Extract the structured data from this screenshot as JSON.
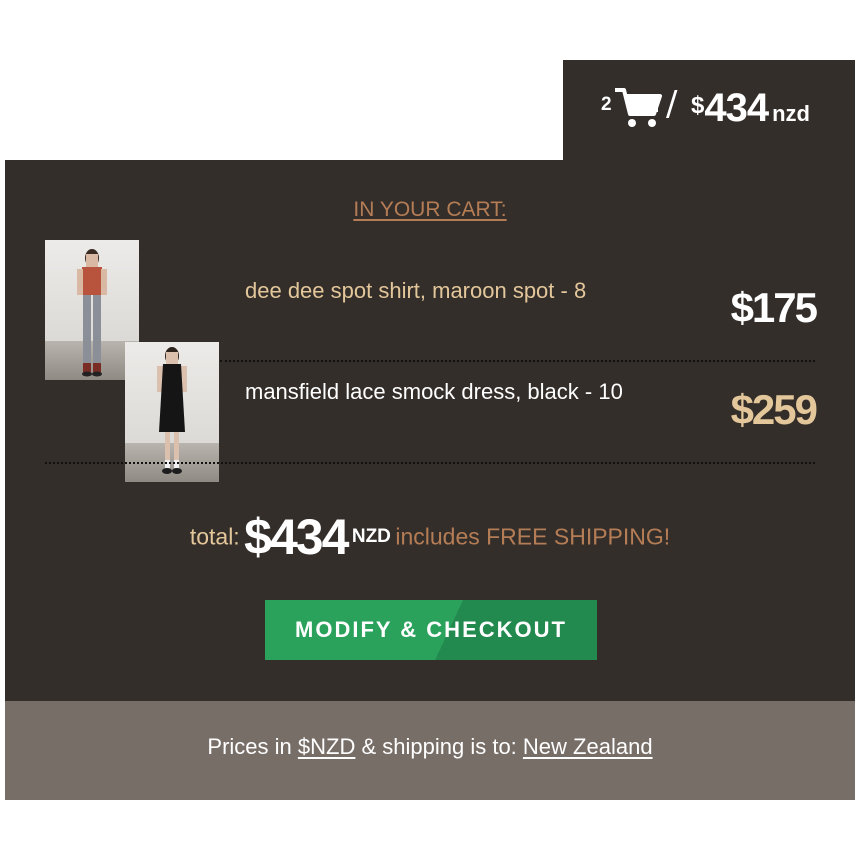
{
  "cart_tab": {
    "count": "2",
    "separator": "/",
    "currency_symbol": "$",
    "total": "434",
    "unit": "nzd",
    "icon": "shopping-cart-icon"
  },
  "cart": {
    "heading": "IN YOUR CART:",
    "items": [
      {
        "name": "dee dee spot shirt, maroon spot - 8",
        "price": "$175",
        "name_color": "#e3c79a",
        "price_color": "#ffffff",
        "image": "model wearing maroon spot shirt and grey trousers"
      },
      {
        "name": "mansfield lace smock dress, black - 10",
        "price": "$259",
        "name_color": "#ffffff",
        "price_color": "#e3c79a",
        "image": "model wearing black lace smock dress"
      }
    ]
  },
  "totals": {
    "label": "total:",
    "amount": "$434",
    "unit": "NZD",
    "note": "includes FREE SHIPPING!"
  },
  "checkout_button": {
    "label": "MODIFY & CHECKOUT"
  },
  "footer": {
    "prefix": "Prices in",
    "currency_link": "$NZD",
    "middle": "& shipping is to:",
    "country_link": "New Zealand"
  },
  "colors": {
    "panel_bg": "#342e2b",
    "footer_bg": "#786e68",
    "accent_tan": "#e3c79a",
    "accent_copper": "#b57d55",
    "button_green": "#2aa25c"
  }
}
